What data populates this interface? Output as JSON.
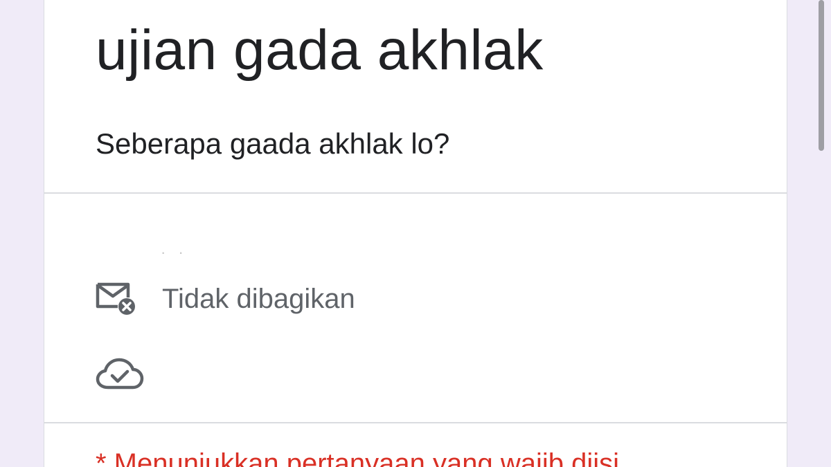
{
  "form": {
    "title": "ujian gada akhlak",
    "description": "Seberapa gaada akhlak lo?"
  },
  "account": {
    "hidden_email": "· ·",
    "email_status": "Tidak dibagikan",
    "email_icon": "mail-not-shared-icon",
    "save_icon": "cloud-check-icon"
  },
  "required": {
    "note": "* Menunjukkan pertanyaan yang wajib diisi"
  },
  "colors": {
    "background": "#f0ebf8",
    "required": "#d93025",
    "icon": "#5f6368"
  }
}
